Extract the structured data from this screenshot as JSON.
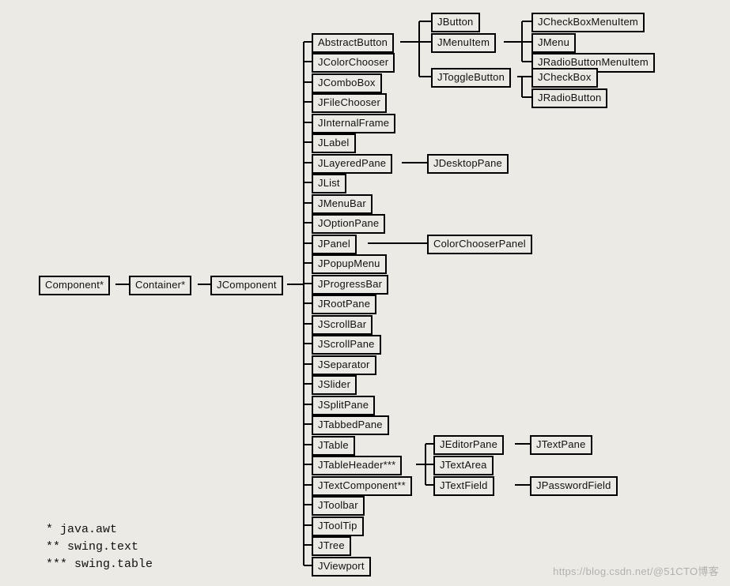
{
  "nodes": {
    "component": "Component*",
    "container": "Container*",
    "jcomponent": "JComponent",
    "abstractbutton": "AbstractButton",
    "jcolorchooser": "JColorChooser",
    "jcombobox": "JComboBox",
    "jfilechooser": "JFileChooser",
    "jinternalframe": "JInternalFrame",
    "jlabel": "JLabel",
    "jlayeredpane": "JLayeredPane",
    "jlist": "JList",
    "jmenubar": "JMenuBar",
    "joptionpane": "JOptionPane",
    "jpanel": "JPanel",
    "jpopupmenu": "JPopupMenu",
    "jprogressbar": "JProgressBar",
    "jrootpane": "JRootPane",
    "jscrollbar": "JScrollBar",
    "jscrollpane": "JScrollPane",
    "jseparator": "JSeparator",
    "jslider": "JSlider",
    "jsplitpane": "JSplitPane",
    "jtabbedpane": "JTabbedPane",
    "jtable": "JTable",
    "jtableheader": "JTableHeader***",
    "jtextcomponent": "JTextComponent**",
    "jtoolbar": "JToolbar",
    "jtooltip": "JToolTip",
    "jtree": "JTree",
    "jviewport": "JViewport",
    "jbutton": "JButton",
    "jmenuitem": "JMenuItem",
    "jtogglebutton": "JToggleButton",
    "jcheckboxmenuitem": "JCheckBoxMenuItem",
    "jmenu": "JMenu",
    "jradiobuttonmenuitem": "JRadioButtonMenuItem",
    "jcheckbox": "JCheckBox",
    "jradiobutton": "JRadioButton",
    "jdesktoppane": "JDesktopPane",
    "colorchooserpanel": "ColorChooserPanel",
    "jeditorpane": "JEditorPane",
    "jtextarea": "JTextArea",
    "jtextfield": "JTextField",
    "jtextpane": "JTextPane",
    "jpasswordfield": "JPasswordField"
  },
  "legend": {
    "line1": "*  java.awt",
    "line2": "** swing.text",
    "line3": "*** swing.table"
  },
  "footer": "https://blog.csdn.net/@51CTO博客"
}
